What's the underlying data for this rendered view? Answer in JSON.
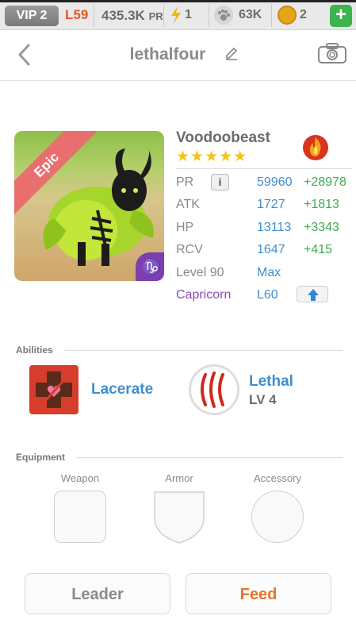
{
  "status_bar": {
    "vip": "VIP 2",
    "level": "L59",
    "power_value": "435.3K",
    "power_unit": "PR",
    "energy": "1",
    "food": "63K",
    "coins": "2",
    "plus_label": "+"
  },
  "header": {
    "title": "lethalfour",
    "icons": [
      "back-icon",
      "edit-icon",
      "camera-icon"
    ]
  },
  "pet": {
    "name": "Voodoobeast",
    "rarity": "Epic",
    "stars": "★★★★★",
    "star_count": 5,
    "element": "fire-icon",
    "zodiac_symbol": "♑",
    "stats": {
      "pr": {
        "label": "PR",
        "value": "59960",
        "bonus": "+28978"
      },
      "atk": {
        "label": "ATK",
        "value": "1727",
        "bonus": "+1813"
      },
      "hp": {
        "label": "HP",
        "value": "13113",
        "bonus": "+3343"
      },
      "rcv": {
        "label": "RCV",
        "value": "1647",
        "bonus": "+415"
      }
    },
    "info_label": "i",
    "level_label": "Level 90",
    "level_value": "Max",
    "zodiac": "Capricorn",
    "zodiac_level": "L60"
  },
  "abilities": {
    "title": "Abilities",
    "items": [
      {
        "name": "Lacerate",
        "icon": "lacerate-icon"
      },
      {
        "name": "Lethal",
        "level": "LV 4",
        "icon": "claw-icon"
      }
    ]
  },
  "equipment": {
    "title": "Equipment",
    "slots": [
      "Weapon",
      "Armor",
      "Accessory"
    ]
  },
  "buttons": {
    "leader": "Leader",
    "feed": "Feed"
  },
  "colors": {
    "accent_blue": "#3f8fcf",
    "bonus_green": "#3bb04f",
    "feed_orange": "#e8752a",
    "zodiac_purple": "#8d49b8",
    "rarity_epic": "#e96f6f"
  }
}
